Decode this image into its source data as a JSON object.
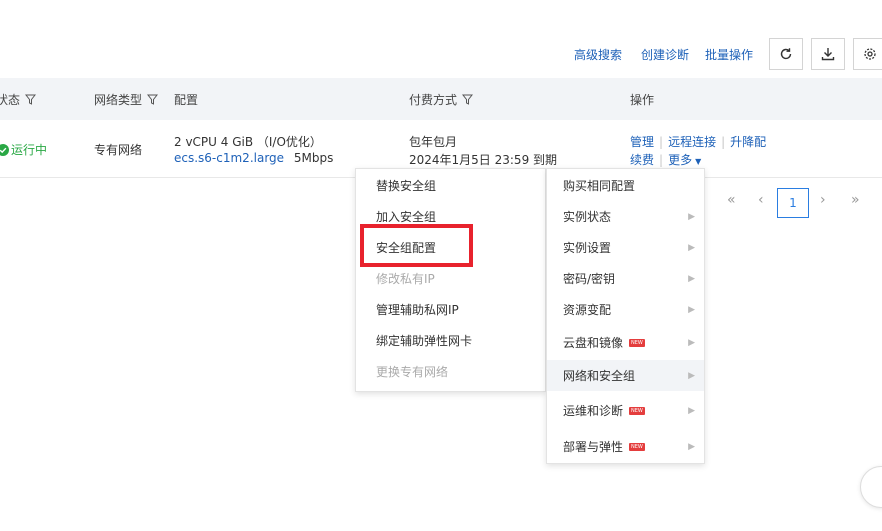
{
  "toolbar": {
    "advanced_search": "高级搜索",
    "create_diagnosis": "创建诊断",
    "batch_ops": "批量操作",
    "refresh_icon": "refresh-icon",
    "download_icon": "download-icon",
    "settings_icon": "gear-icon"
  },
  "table": {
    "headers": {
      "status": "状态",
      "network_type": "网络类型",
      "config": "配置",
      "billing": "付费方式",
      "actions": "操作"
    },
    "row": {
      "status": "运行中",
      "network_type": "专有网络",
      "config_line1": "2 vCPU 4 GiB （I/O优化）",
      "instance_type": "ecs.s6-c1m2.large",
      "bandwidth": "5Mbps",
      "billing_type": "包年包月",
      "expire": "2024年1月5日 23:59 到期",
      "action_manage": "管理",
      "action_remote": "远程连接",
      "action_upgrade": "升降配",
      "action_renew": "续费",
      "action_more": "更多"
    }
  },
  "pagination": {
    "current": "1"
  },
  "submenu": {
    "items": [
      {
        "label": "替换安全组",
        "disabled": false
      },
      {
        "label": "加入安全组",
        "disabled": false
      },
      {
        "label": "安全组配置",
        "disabled": false
      },
      {
        "label": "修改私有IP",
        "disabled": true
      },
      {
        "label": "管理辅助私网IP",
        "disabled": false
      },
      {
        "label": "绑定辅助弹性网卡",
        "disabled": false
      },
      {
        "label": "更换专有网络",
        "disabled": true
      }
    ]
  },
  "more_menu": {
    "items": [
      {
        "label": "购买相同配置"
      },
      {
        "label": "实例状态"
      },
      {
        "label": "实例设置"
      },
      {
        "label": "密码/密钥"
      },
      {
        "label": "资源变配"
      },
      {
        "label": "云盘和镜像",
        "badge": "NEW"
      },
      {
        "label": "网络和安全组"
      },
      {
        "label": "运维和诊断",
        "badge": "NEW"
      },
      {
        "label": "部署与弹性",
        "badge": "NEW"
      }
    ]
  },
  "colors": {
    "link": "#1e61b8",
    "success": "#2aa845",
    "highlight": "#e8222d",
    "badge": "#e43d3d"
  }
}
